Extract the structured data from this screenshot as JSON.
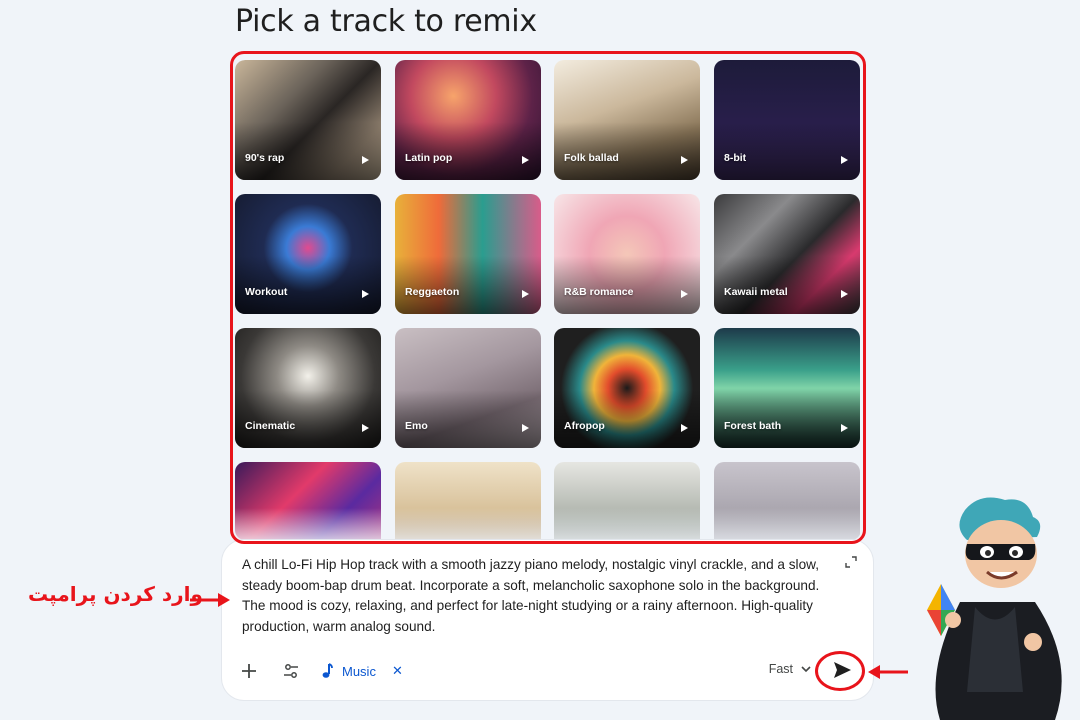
{
  "page": {
    "title": "Pick a track to remix"
  },
  "tracks": [
    {
      "label": "90's rap",
      "art": "linear-gradient(135deg,#c9b69a 0%,#6b635a 35%,#2a2624 55%,#8c7d6c 80%,#c2b197 100%)",
      "deco": "blocks"
    },
    {
      "label": "Latin pop",
      "art": "radial-gradient(circle at 40% 30%,#f7a46b 0%,#c2495f 35%,#5d2248 65%,#2c1330 100%)",
      "deco": "dots"
    },
    {
      "label": "Folk ballad",
      "art": "linear-gradient(160deg,#f3ecdf 0%,#cbb89c 40%,#8a7659 70%,#4d4030 100%)",
      "deco": "none"
    },
    {
      "label": "8-bit",
      "art": "linear-gradient(180deg,#1d1b3a 0%,#2a1f4d 60%,#3b2a5e 100%)",
      "deco": "arcade"
    },
    {
      "label": "Workout",
      "art": "radial-gradient(circle at 50% 45%,#e24a8f 0%,#3a7bd5 22%,#1f2b52 45%,#151a2e 100%)",
      "deco": "ring"
    },
    {
      "label": "Reggaeton",
      "art": "linear-gradient(90deg,#e8b13a 0%,#ef6b3a 30%,#2a9d8f 60%,#d95c8a 100%)",
      "deco": "speaker"
    },
    {
      "label": "R&B romance",
      "art": "radial-gradient(circle at 50% 50%,#f4c7b8 0%,#f0a6b5 40%,#f7e6e8 100%)",
      "deco": "heart"
    },
    {
      "label": "Kawaii metal",
      "art": "linear-gradient(135deg,#3b3b3d 0%,#8a8a8c 30%,#2a2a2c 55%,#d83a6e 75%,#3b3b3d 100%)",
      "deco": "shards"
    },
    {
      "label": "Cinematic",
      "art": "radial-gradient(ellipse at 50% 40%,#f3f1ea 0%,#8e8a84 30%,#3a3836 65%,#1c1b1a 100%)",
      "deco": "none"
    },
    {
      "label": "Emo",
      "art": "linear-gradient(160deg,#c9bfc3 0%,#a4979f 40%,#7a6c74 70%,#b8acb2 100%)",
      "deco": "none"
    },
    {
      "label": "Afropop",
      "art": "radial-gradient(circle at 50% 50%,#1a1a1a 0%,#e24c2c 20%,#f0b43a 35%,#2a8a8a 50%,#1f1f1f 70%)",
      "deco": "swirl"
    },
    {
      "label": "Forest bath",
      "art": "linear-gradient(180deg,#1d3a4a 0%,#3aa08a 35%,#7fd3a8 50%,#16302d 100%)",
      "deco": "trees"
    },
    {
      "label": "",
      "art": "linear-gradient(135deg,#3a1a5a 0%,#e23a6a 35%,#5a2aa0 60%,#e23a6a 100%)",
      "deco": "none"
    },
    {
      "label": "",
      "art": "linear-gradient(180deg,#efe2c8 0%,#d8c19a 40%,#8a6a48 100%)",
      "deco": "none"
    },
    {
      "label": "",
      "art": "linear-gradient(180deg,#e6e6e2 0%,#a8aea6 50%,#5a625c 100%)",
      "deco": "none"
    },
    {
      "label": "",
      "art": "linear-gradient(180deg,#c8c4cc 0%,#9b97a0 60%,#3c3b40 100%)",
      "deco": "none"
    }
  ],
  "prompt": {
    "text": "A chill Lo-Fi Hip Hop track with a smooth jazzy piano melody, nostalgic vinyl crackle, and a slow, steady boom-bap drum beat. Incorporate a soft, melancholic saxophone solo in the background. The mood is cozy, relaxing, and perfect for late-night studying or a rainy afternoon. High-quality production, warm analog sound.",
    "chip_label": "Music",
    "chip_close": "✕",
    "mode": "Fast"
  },
  "annotation": {
    "label": "وارد کردن پرامپت"
  },
  "colors": {
    "accent": "#0b57d0",
    "annotation": "#e8141b",
    "background": "#f0f4f9"
  },
  "icons": [
    "plus-icon",
    "tools-icon",
    "music-note-icon",
    "chevron-down-icon",
    "send-icon",
    "expand-icon",
    "play-icon"
  ]
}
